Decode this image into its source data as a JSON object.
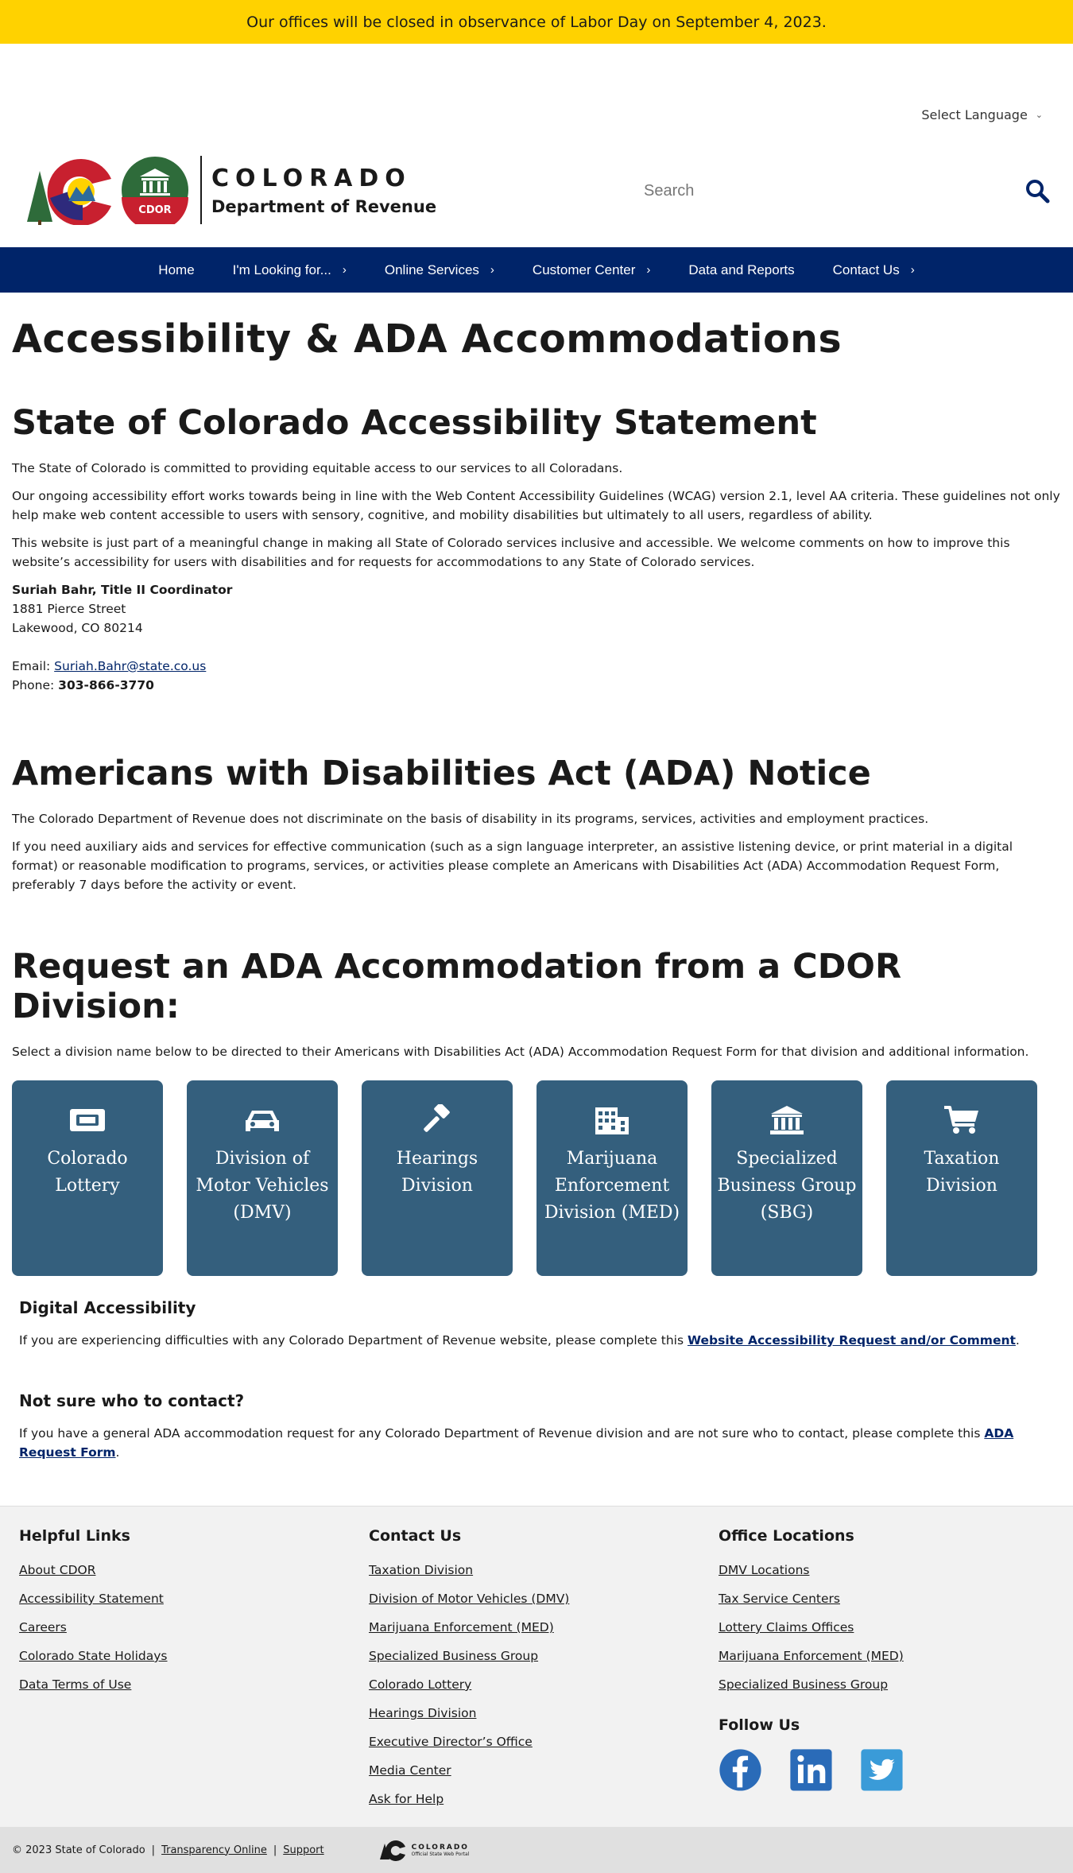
{
  "alert": "Our offices will be closed in observance of Labor Day on September 4, 2023.",
  "header": {
    "language_label": "Select Language",
    "logo_title": "COLORADO",
    "logo_sub": "Department of Revenue",
    "seal_text": "CDOR",
    "search_placeholder": "Search"
  },
  "nav": [
    {
      "label": "Home",
      "chevron": false
    },
    {
      "label": "I'm Looking for...",
      "chevron": true
    },
    {
      "label": "Online Services",
      "chevron": true
    },
    {
      "label": "Customer Center",
      "chevron": true
    },
    {
      "label": "Data and Reports",
      "chevron": false
    },
    {
      "label": "Contact Us",
      "chevron": true
    }
  ],
  "page": {
    "title": "Accessibility & ADA Accommodations",
    "statement": {
      "heading": "State of Colorado Accessibility Statement",
      "paragraphs": [
        "The State of Colorado is committed to providing equitable access to our services to all Coloradans.",
        "Our ongoing accessibility effort works towards being in line with the Web Content Accessibility Guidelines (WCAG) version 2.1, level AA criteria. These guidelines not only help make web content accessible to users with sensory, cognitive, and mobility disabilities but ultimately to all users, regardless of ability.",
        "This website is just part of a meaningful change in making all State of Colorado services inclusive and accessible. We welcome comments on how to improve this website’s accessibility for users with disabilities and for requests for accommodations to any State of Colorado services."
      ],
      "coordinator_name": "Suriah Bahr, Title II Coordinator",
      "address_1": "1881 Pierce Street",
      "address_2": "Lakewood, CO 80214",
      "email_label": "Email: ",
      "email": "Suriah.Bahr@state.co.us",
      "phone_label": "Phone: ",
      "phone": "303-866-3770"
    },
    "ada": {
      "heading": "Americans with Disabilities Act (ADA) Notice",
      "paragraphs": [
        "The Colorado Department of Revenue does not discriminate on the basis of disability in its programs, services, activities and employment practices.",
        "If you need auxiliary aids and services for effective communication (such as a sign language interpreter, an assistive listening device, or print material in a digital format) or reasonable modification to programs, services, or activities please complete an Americans with Disabilities Act (ADA) Accommodation Request Form, preferably 7 days before the activity or event."
      ]
    },
    "request": {
      "heading": "Request an ADA Accommodation from a CDOR Division:",
      "intro": "Select a division name below to be directed to their Americans with Disabilities Act (ADA) Accommodation Request Form for that division and additional information.",
      "cards": [
        {
          "label": "Colorado Lottery",
          "icon": "ticket-icon"
        },
        {
          "label": "Division of Motor Vehicles (DMV)",
          "icon": "car-icon"
        },
        {
          "label": "Hearings Division",
          "icon": "gavel-icon"
        },
        {
          "label": "Marijuana Enforcement Division (MED)",
          "icon": "building-icon"
        },
        {
          "label": "Specialized Business Group (SBG)",
          "icon": "institution-icon"
        },
        {
          "label": "Taxation Division",
          "icon": "cart-icon"
        }
      ]
    },
    "digital": {
      "heading": "Digital Accessibility",
      "text_before": "If you are experiencing difficulties with any Colorado Department of Revenue website, please complete this ",
      "link": "Website Accessibility Request and/or Comment",
      "text_after": "."
    },
    "notsure": {
      "heading": "Not sure who to contact?",
      "text_before": "If you have a general ADA accommodation request for any Colorado Department of Revenue division and are not sure who to contact, please complete this ",
      "link": "ADA Request Form",
      "text_after": "."
    }
  },
  "footer": {
    "helpful": {
      "heading": "Helpful Links",
      "links": [
        "About CDOR",
        "Accessibility Statement",
        "Careers",
        "Colorado State Holidays",
        "Data Terms of Use"
      ]
    },
    "contact": {
      "heading": "Contact Us",
      "links": [
        "Taxation Division",
        "Division of Motor Vehicles (DMV)",
        "Marijuana Enforcement (MED)",
        "Specialized Business Group",
        "Colorado Lottery",
        "Hearings Division",
        "Executive Director’s Office",
        "Media Center",
        "Ask for Help"
      ]
    },
    "offices": {
      "heading": "Office Locations",
      "links": [
        "DMV Locations",
        "Tax Service Centers",
        "Lottery Claims Offices",
        "Marijuana Enforcement (MED)",
        "Specialized Business Group"
      ]
    },
    "follow_heading": "Follow Us",
    "social": [
      "facebook-icon",
      "linkedin-icon",
      "twitter-icon"
    ],
    "copyright": "© 2023 State of Colorado",
    "sep": "|",
    "transparency": "Transparency Online",
    "support": "Support",
    "portal_title": "COLORADO",
    "portal_sub": "Official State Web Portal"
  },
  "colors": {
    "alert": "#ffd200",
    "nav": "#002469",
    "card": "#345f7d",
    "footer": "#f2f2f2"
  }
}
